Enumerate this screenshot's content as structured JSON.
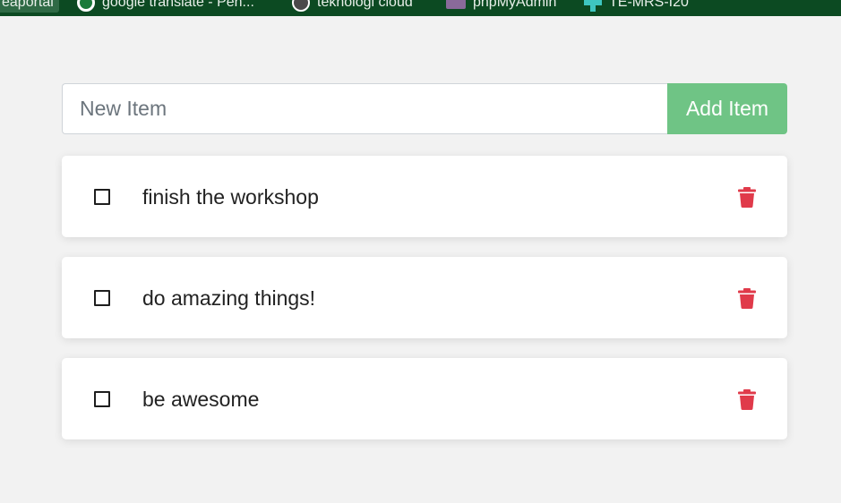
{
  "bookmarks": [
    {
      "label": "eaportal",
      "icon": "bookmark-icon"
    },
    {
      "label": "google translate - Pen...",
      "icon": "google-icon"
    },
    {
      "label": "teknologi cloud",
      "icon": "globe-icon"
    },
    {
      "label": "phpMyAdmin",
      "icon": "phpmyadmin-icon"
    },
    {
      "label": "TE-MRS-I20",
      "icon": "cross-icon"
    }
  ],
  "form": {
    "placeholder": "New Item",
    "value": "",
    "add_label": "Add Item"
  },
  "todos": [
    {
      "text": "finish the workshop",
      "done": false
    },
    {
      "text": "do amazing things!",
      "done": false
    },
    {
      "text": "be awesome",
      "done": false
    }
  ],
  "colors": {
    "top_bar": "#0c4a22",
    "add_button": "#6fc485",
    "delete_icon": "#e03a4a",
    "background": "#f2f2f2"
  }
}
